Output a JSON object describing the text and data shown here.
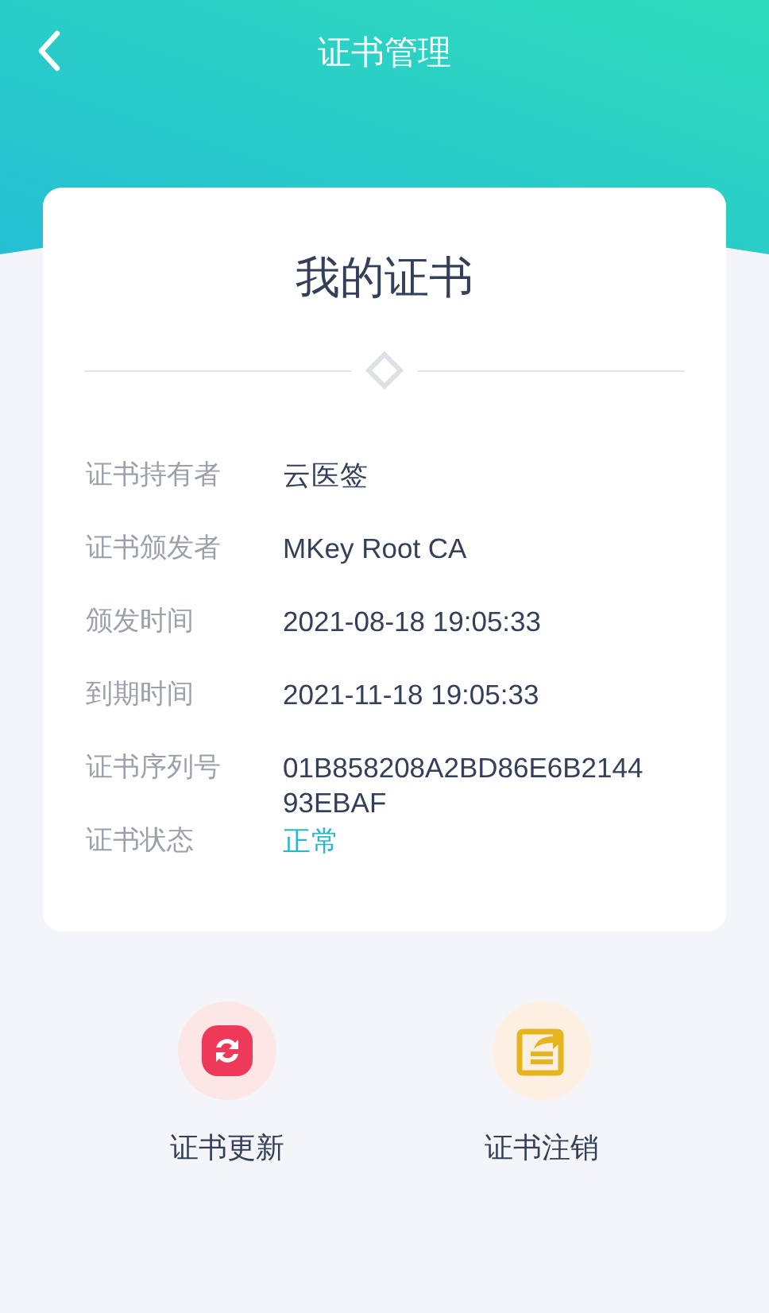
{
  "nav": {
    "title": "证书管理"
  },
  "card": {
    "title": "我的证书",
    "rows": [
      {
        "label": "证书持有者",
        "value": "云医签",
        "kind": "text"
      },
      {
        "label": "证书颁发者",
        "value": "MKey Root CA",
        "kind": "text"
      },
      {
        "label": "颁发时间",
        "value": "2021-08-18 19:05:33",
        "kind": "text"
      },
      {
        "label": "到期时间",
        "value": "2021-11-18 19:05:33",
        "kind": "text"
      },
      {
        "label": "证书序列号",
        "value": "01B858208A2BD86E6B214493EBAF",
        "kind": "text"
      },
      {
        "label": "证书状态",
        "value": "正常",
        "kind": "status"
      }
    ]
  },
  "actions": [
    {
      "label": "证书更新",
      "kind": "renew"
    },
    {
      "label": "证书注销",
      "kind": "revoke"
    }
  ]
}
